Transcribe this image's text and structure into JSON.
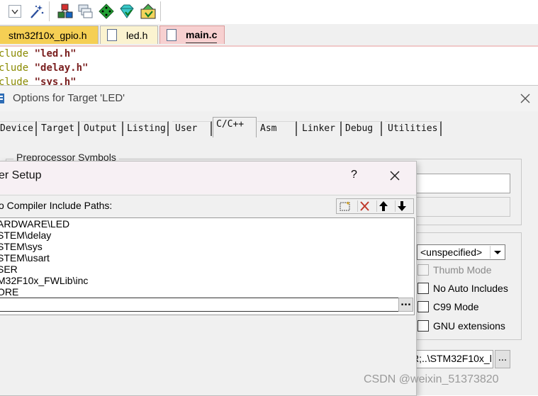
{
  "toolbar": {
    "icons": [
      "dropdown-arrow-icon",
      "magic-wand-icon",
      "file-extensions-icon",
      "stacked-windows-icon",
      "diamond-green-icon",
      "diamond-cyan-icon",
      "manage-run-time-icon"
    ]
  },
  "editor": {
    "tabs": [
      {
        "label": "stm32f10x_gpio.h",
        "active": false
      },
      {
        "label": "led.h",
        "active": false
      },
      {
        "label": "main.c",
        "active": true
      }
    ],
    "code_lines": [
      {
        "keyword": "clude",
        "value": "\"led.h\""
      },
      {
        "keyword": "clude",
        "value": "\"delay.h\""
      },
      {
        "keyword": "clude",
        "value": "\"sys.h\""
      }
    ]
  },
  "options_dialog": {
    "title": "Options for Target 'LED'",
    "tabs": [
      "Device",
      "Target",
      "Output",
      "Listing",
      "User",
      "C/C++",
      "Asm",
      "Linker",
      "Debug",
      "Utilities"
    ],
    "active_tab": "C/C++",
    "group_preprocessor": "Preprocessor Symbols",
    "select_value": "<unspecified>",
    "options": [
      {
        "label": "Thumb Mode",
        "disabled": true
      },
      {
        "label": "No Auto Includes",
        "disabled": false
      },
      {
        "label": "C99 Mode",
        "disabled": false
      },
      {
        "label": "GNU extensions",
        "disabled": false
      }
    ],
    "include_paths_value": "R;..\\STM32F10x_l",
    "browse_label": "..."
  },
  "folder_setup": {
    "title": "er Setup",
    "help": "?",
    "close": "✕",
    "list_label": "o Compiler Include Paths:",
    "paths": [
      "ARDWARE\\LED",
      "STEM\\delay",
      "STEM\\sys",
      "STEM\\usart",
      "SER",
      "M32F10x_FWLib\\inc",
      "ORE"
    ],
    "browse_label": "...",
    "colors": {
      "delete": "#c0392b"
    }
  },
  "watermark": "CSDN @weixin_51373820"
}
